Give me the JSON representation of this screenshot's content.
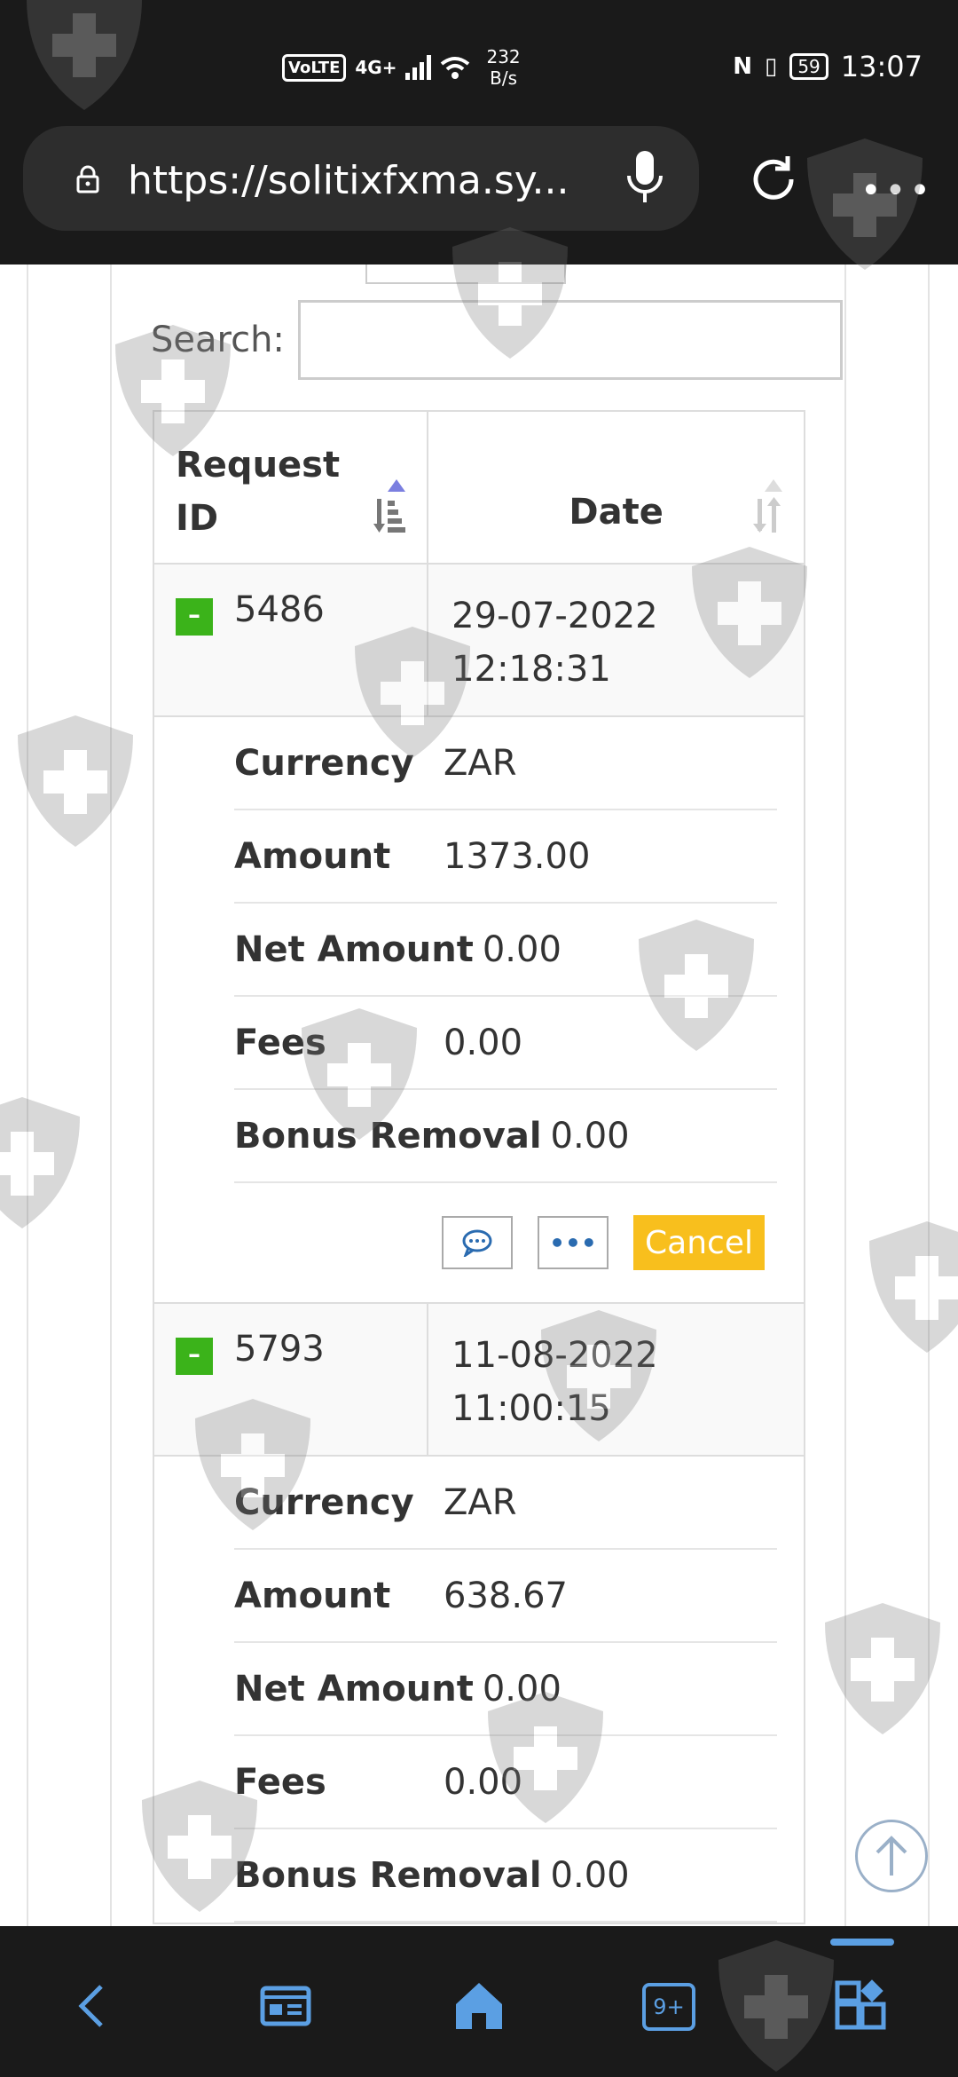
{
  "status_bar": {
    "volte": "VoLTE",
    "network": "4G+",
    "speed_value": "232",
    "speed_unit": "B/s",
    "battery": "59",
    "time": "13:07"
  },
  "browser": {
    "url": "https://solitixfxma.sy...",
    "more": "•••"
  },
  "search": {
    "label": "Search:",
    "placeholder": "",
    "value": ""
  },
  "table": {
    "headers": {
      "request_id": "Request ID",
      "request_id_line1": "Request",
      "request_id_line2": "ID",
      "date": "Date"
    },
    "rows": [
      {
        "id": "5486",
        "date": "29-07-2022",
        "time": "12:18:31",
        "expand_symbol": "–",
        "details": {
          "currency_label": "Currency",
          "currency": "ZAR",
          "amount_label": "Amount",
          "amount": "1373.00",
          "net_amount_label": "Net Amount",
          "net_amount": "0.00",
          "fees_label": "Fees",
          "fees": "0.00",
          "bonus_removal_label": "Bonus Removal",
          "bonus_removal": "0.00"
        },
        "actions": {
          "more": "•••",
          "cancel": "Cancel"
        }
      },
      {
        "id": "5793",
        "date": "11-08-2022",
        "time": "11:00:15",
        "expand_symbol": "–",
        "details": {
          "currency_label": "Currency",
          "currency": "ZAR",
          "amount_label": "Amount",
          "amount": "638.67",
          "net_amount_label": "Net Amount",
          "net_amount": "0.00",
          "fees_label": "Fees",
          "fees": "0.00",
          "bonus_removal_label": "Bonus Removal",
          "bonus_removal": "0.00"
        }
      }
    ]
  },
  "bottom_nav": {
    "tabs_count": "9+"
  },
  "colors": {
    "expand_green": "#3bb31a",
    "cancel_yellow": "#f8bf1d",
    "link_blue": "#2a6bb0",
    "nav_blue": "#5b9fe3"
  },
  "icons": [
    "lock-icon",
    "mic-icon",
    "reload-icon",
    "more-icon",
    "sort-icon",
    "comment-icon",
    "scroll-top-icon",
    "back-icon",
    "news-icon",
    "home-icon",
    "tabs-icon",
    "apps-icon",
    "shield-watermark-icon"
  ]
}
